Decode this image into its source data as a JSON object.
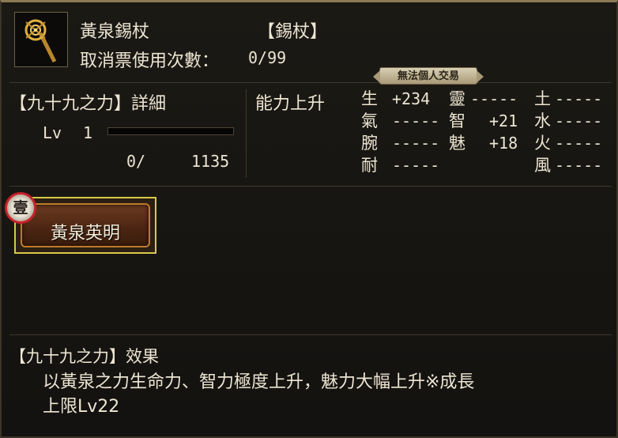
{
  "item": {
    "name": "黃泉錫杖",
    "type": "【錫杖】",
    "uses_label": "取消票使用次數：",
    "uses_value": "0/99",
    "trade_badge": "無法個人交易"
  },
  "detail": {
    "heading": "【九十九之力】詳細",
    "level_label": "Lv",
    "level_value": "1",
    "exp_current": "0/",
    "exp_max": "1135",
    "exp_fraction": 0
  },
  "abilities": {
    "heading": "能力上升",
    "stats": [
      {
        "name": "生",
        "value": "+234"
      },
      {
        "name": "氣",
        "value": "-----"
      },
      {
        "name": "腕",
        "value": "-----"
      },
      {
        "name": "耐",
        "value": "-----"
      },
      {
        "name": "靈",
        "value": "-----"
      },
      {
        "name": "智",
        "value": "+21"
      },
      {
        "name": "魅",
        "value": "+18"
      },
      {
        "name": "土",
        "value": "-----"
      },
      {
        "name": "水",
        "value": "-----"
      },
      {
        "name": "火",
        "value": "-----"
      },
      {
        "name": "風",
        "value": "-----"
      }
    ]
  },
  "skill": {
    "badge": "壹",
    "label": "黃泉英明"
  },
  "effect": {
    "heading": "【九十九之力】效果",
    "line1": "以黃泉之力生命力、智力極度上升，魅力大幅上升※成長",
    "line2": "上限Lv22"
  },
  "colors": {
    "background": "#15130f",
    "text": "#ece5d2",
    "skill_border": "#d8c74a",
    "badge_ring": "#c9212a"
  }
}
